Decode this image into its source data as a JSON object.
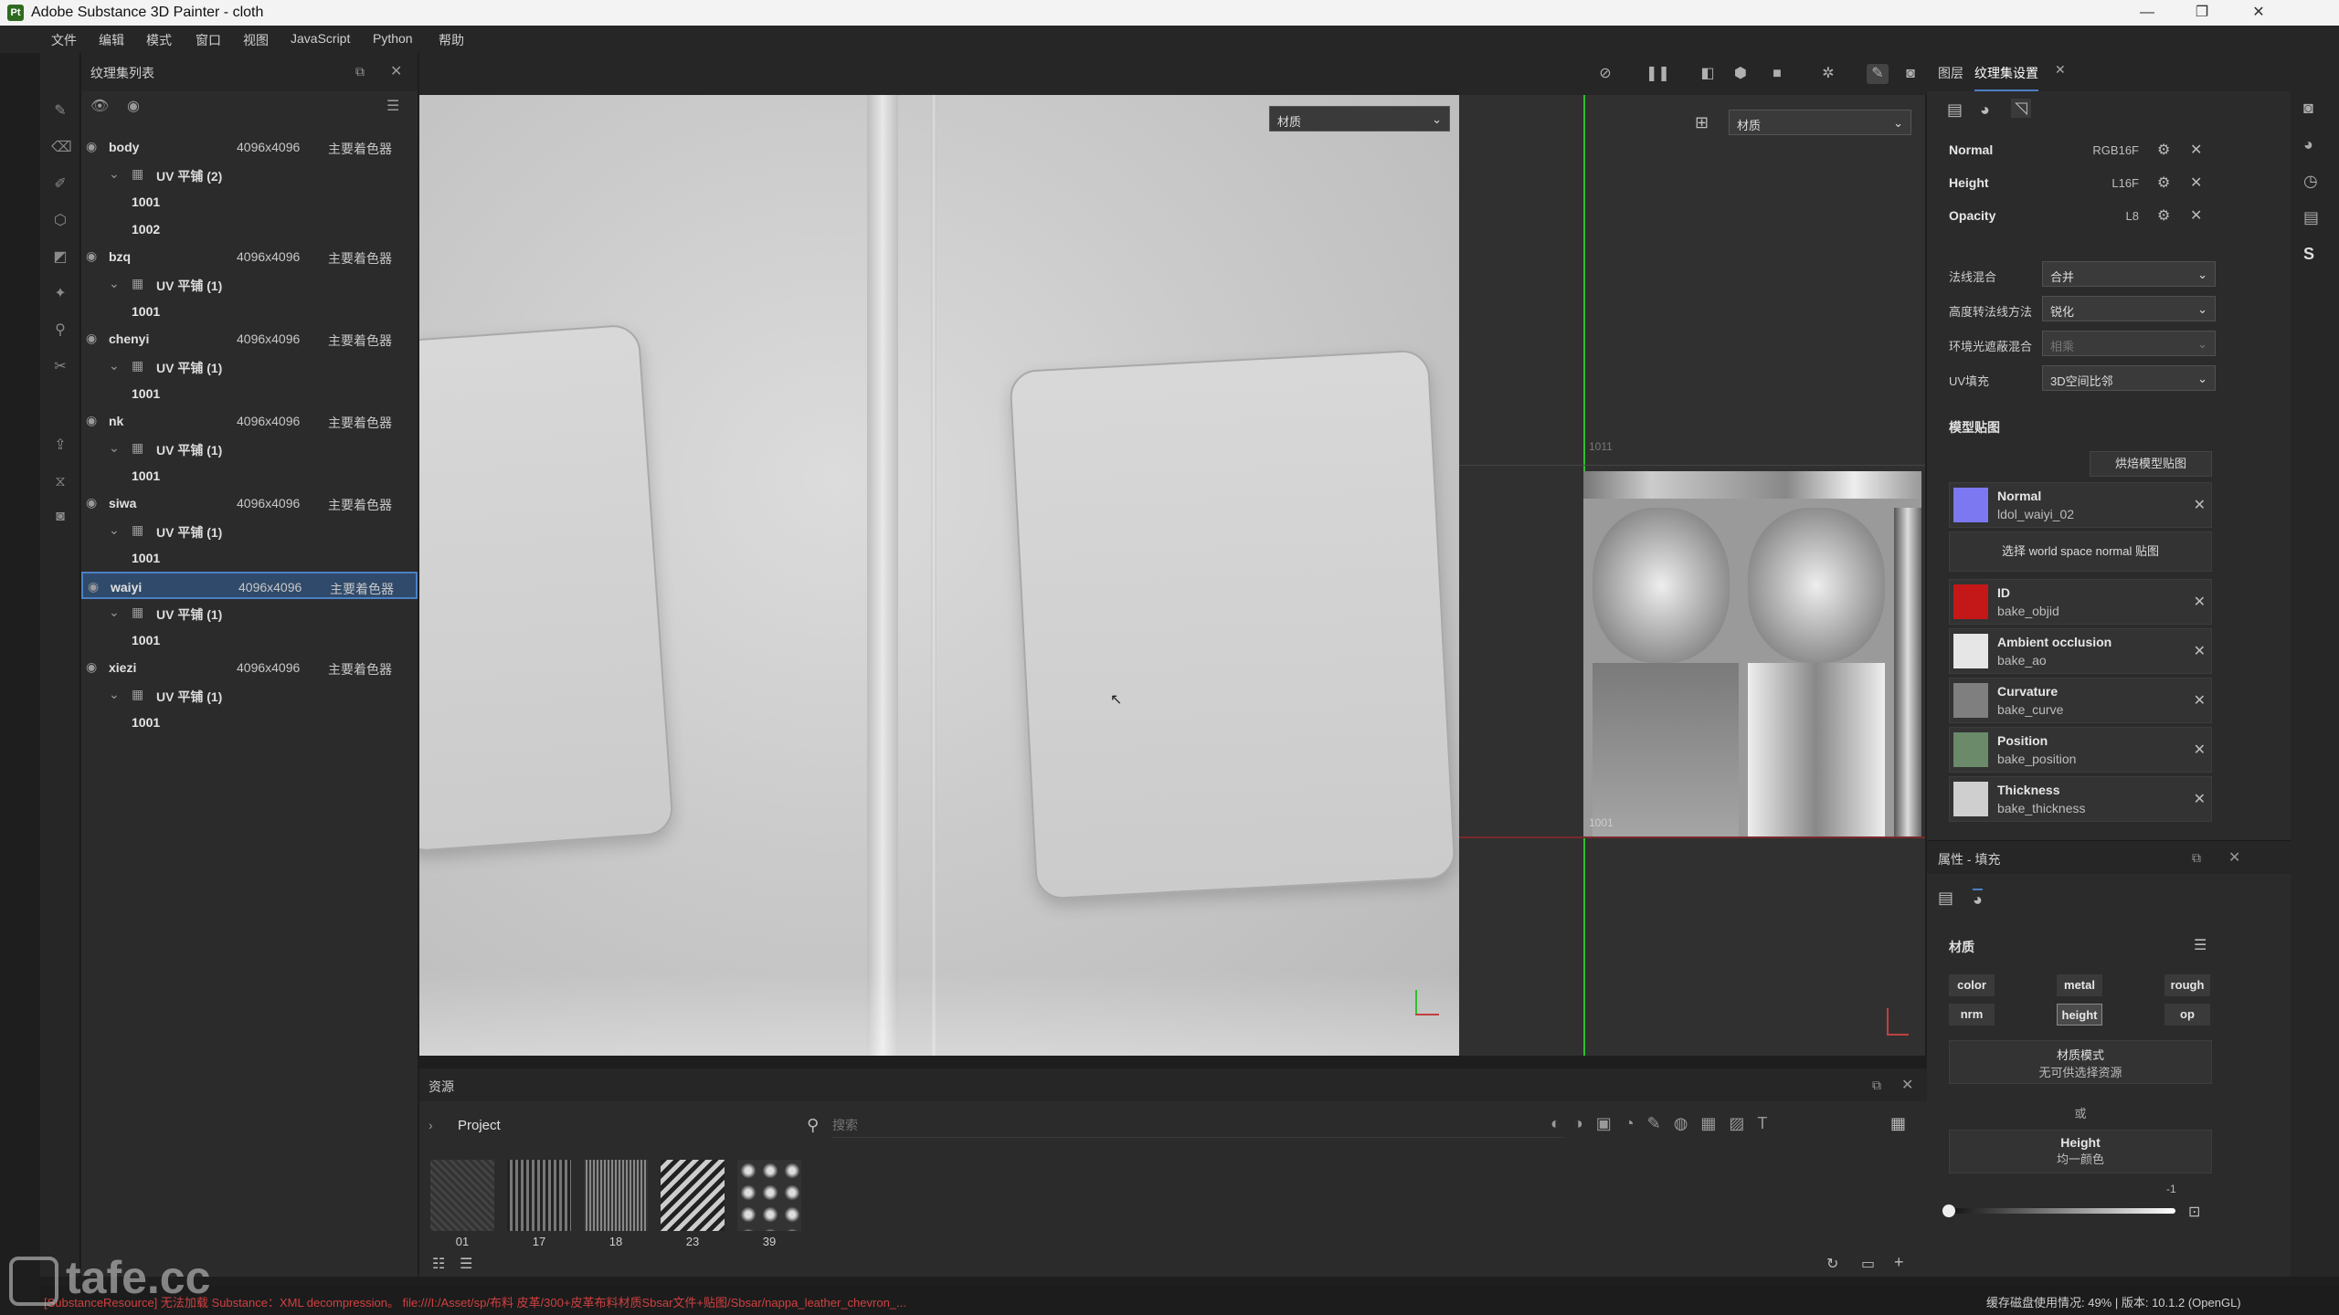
{
  "window": {
    "title": "Adobe Substance 3D Painter - cloth",
    "logo": "Pt",
    "controls": [
      "—",
      "❐",
      "✕"
    ]
  },
  "menu": [
    "文件",
    "编辑",
    "模式",
    "窗口",
    "视图",
    "JavaScript",
    "Python",
    "帮助"
  ],
  "texture_set_list": {
    "title": "纹理集列表",
    "sets": [
      {
        "name": "body",
        "resolution": "4096x4096",
        "shader": "主要着色器",
        "uv_label": "UV 平铺 (2)",
        "tiles": [
          "1001",
          "1002"
        ]
      },
      {
        "name": "bzq",
        "resolution": "4096x4096",
        "shader": "主要着色器",
        "uv_label": "UV 平铺 (1)",
        "tiles": [
          "1001"
        ]
      },
      {
        "name": "chenyi",
        "resolution": "4096x4096",
        "shader": "主要着色器",
        "uv_label": "UV 平铺 (1)",
        "tiles": [
          "1001"
        ]
      },
      {
        "name": "nk",
        "resolution": "4096x4096",
        "shader": "主要着色器",
        "uv_label": "UV 平铺 (1)",
        "tiles": [
          "1001"
        ]
      },
      {
        "name": "siwa",
        "resolution": "4096x4096",
        "shader": "主要着色器",
        "uv_label": "UV 平铺 (1)",
        "tiles": [
          "1001"
        ]
      },
      {
        "name": "waiyi",
        "resolution": "4096x4096",
        "shader": "主要着色器",
        "uv_label": "UV 平铺 (1)",
        "tiles": [
          "1001"
        ],
        "selected": true
      },
      {
        "name": "xiezi",
        "resolution": "4096x4096",
        "shader": "主要着色器",
        "uv_label": "UV 平铺 (1)",
        "tiles": [
          "1001"
        ]
      }
    ]
  },
  "viewport": {
    "view3d_mode": "材质",
    "view2d_mode": "材质",
    "uv_tile_label": "1001",
    "uv_tile_label_top": "1011"
  },
  "texture_set_settings": {
    "tab_layers": "图层",
    "tab_settings": "纹理集设置",
    "channels": [
      {
        "name": "Normal",
        "format": "RGB16F"
      },
      {
        "name": "Height",
        "format": "L16F"
      },
      {
        "name": "Opacity",
        "format": "L8"
      }
    ],
    "fields": [
      {
        "label": "法线混合",
        "value": "合并"
      },
      {
        "label": "高度转法线方法",
        "value": "锐化"
      },
      {
        "label": "环境光遮蔽混合",
        "value": "相乘"
      },
      {
        "label": "UV填充",
        "value": "3D空间比邻"
      }
    ],
    "mesh_maps_title": "模型贴图",
    "bake_button": "烘焙模型贴图",
    "world_normal_button": "选择 world space normal 贴图",
    "mesh_maps": [
      {
        "type": "Normal",
        "file": "ldol_waiyi_02",
        "color": "#7b78f2"
      },
      {
        "type": "ID",
        "file": "bake_objid",
        "color": "#c41818"
      },
      {
        "type": "Ambient occlusion",
        "file": "bake_ao",
        "color": "#e6e6e6"
      },
      {
        "type": "Curvature",
        "file": "bake_curve",
        "color": "#7f7f7f"
      },
      {
        "type": "Position",
        "file": "bake_position",
        "color": "#6a8a6a"
      },
      {
        "type": "Thickness",
        "file": "bake_thickness",
        "color": "#cfcfcf"
      }
    ]
  },
  "properties_fill": {
    "title": "属性 - 填充",
    "material_label": "材质",
    "channel_buttons": [
      "color",
      "metal",
      "rough",
      "nrm",
      "height",
      "op"
    ],
    "active_channel": "height",
    "material_mode_title": "材质模式",
    "material_mode_sub": "无可供选择资源",
    "or_label": "或",
    "height_title": "Height",
    "height_sub": "均一颜色",
    "slider_value": "-1",
    "slider_fraction": 0.0
  },
  "assets": {
    "title": "资源",
    "breadcrumb": "Project",
    "search_placeholder": "搜索",
    "thumbnails": [
      "01",
      "17",
      "18",
      "23",
      "39"
    ]
  },
  "status": {
    "error_text": "[SubstanceResource] 无法加载 Substance：XML decompression。 file:///I:/Asset/sp/布料 皮革/300+皮革布料材质Sbsar文件+贴图/Sbsar/nappa_leather_chevron_...",
    "right_text": "缓存磁盘使用情况: 49% | 版本: 10.1.2 (OpenGL)"
  },
  "watermark": "tafe.cc",
  "colors": {
    "accent": "#4b7fc5",
    "error": "#d04040",
    "green_axis": "#2ec02e",
    "red_axis": "#a03030"
  }
}
